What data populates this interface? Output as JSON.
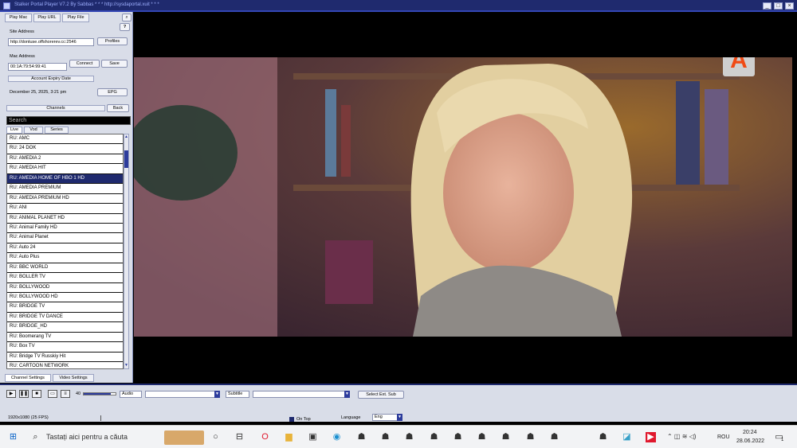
{
  "window": {
    "title": "Stalker Portal Player V7.2 By Sabbas * * * http://sysdaportal.xuit * * *"
  },
  "top_tabs": [
    "Play Mac",
    "Play URL",
    "Play File"
  ],
  "help_label": "?",
  "site": {
    "label": "Site Address",
    "value": "http://dontuse.offshorerev.cc:2546",
    "profiles_label": "Profiles"
  },
  "mac": {
    "label": "Mac Address",
    "value": "00:1A:79:54:99:41",
    "connect_label": "Connect",
    "save_label": "Save"
  },
  "expiry": {
    "label": "Account Expiry Date",
    "value": "December 25, 2025, 3:21 pm",
    "epg_label": "EPG"
  },
  "channels_header": {
    "label": "Channels",
    "back_label": "Back"
  },
  "search": {
    "placeholder": "Search"
  },
  "list_tabs": [
    "Live",
    "Vod",
    "Series"
  ],
  "channels": [
    "RU: AMC",
    "RU: 24 DOK",
    "RU: AMEDIA 2",
    "RU: AMEDIA HIT",
    "RU: AMEDIA HOME OF HBO 1 HD",
    "RU: AMEDIA PREMIUM",
    "RU: AMEDIA PREMIUM HD",
    "RU: ANI",
    "RU: ANIMAL PLANET HD",
    "RU: Animal Family HD",
    "RU: Animal Planet",
    "RU: Auto 24",
    "RU: Auto Plus",
    "RU: BBC WORLD",
    "RU: BOLLER TV",
    "RU: BOLLYWOOD",
    "RU: BOLLYWOOD HD",
    "RU: BRIDGE TV",
    "RU: BRIDGE TV DANCE",
    "RU: BRIDGE_HD",
    "RU: Boomerang TV",
    "RU: Box TV",
    "RU: Bridge TV Russkiy Hit",
    "RU: CARTOON NETWORK"
  ],
  "selected_channel_index": 4,
  "bottom_tabs": [
    "Channel Settings",
    "Video Settings"
  ],
  "controls": {
    "volume_label": "40",
    "volume_level": 0.85,
    "audio_label": "Audio",
    "subtitle_label": "Subtitle",
    "select_sub_label": "Select Ext. Sub",
    "status_text": "1920x1080   (25 FPS)",
    "on_top_label": "On Top",
    "language_label": "Language",
    "language_value": "Eng"
  },
  "video": {
    "channel_logo": "A"
  },
  "taskbar": {
    "search_placeholder": "Tastați aici pentru a căuta",
    "lang": "ROU",
    "time": "20:24",
    "date": "28.06.2022",
    "notif_count": "1"
  },
  "colors": {
    "titlebar": "#1f2a6e",
    "selection": "#1f2a6e",
    "panel": "#d9dde8",
    "logo_bg": "#cfcfcf",
    "logo_fg": "#f04a14"
  }
}
